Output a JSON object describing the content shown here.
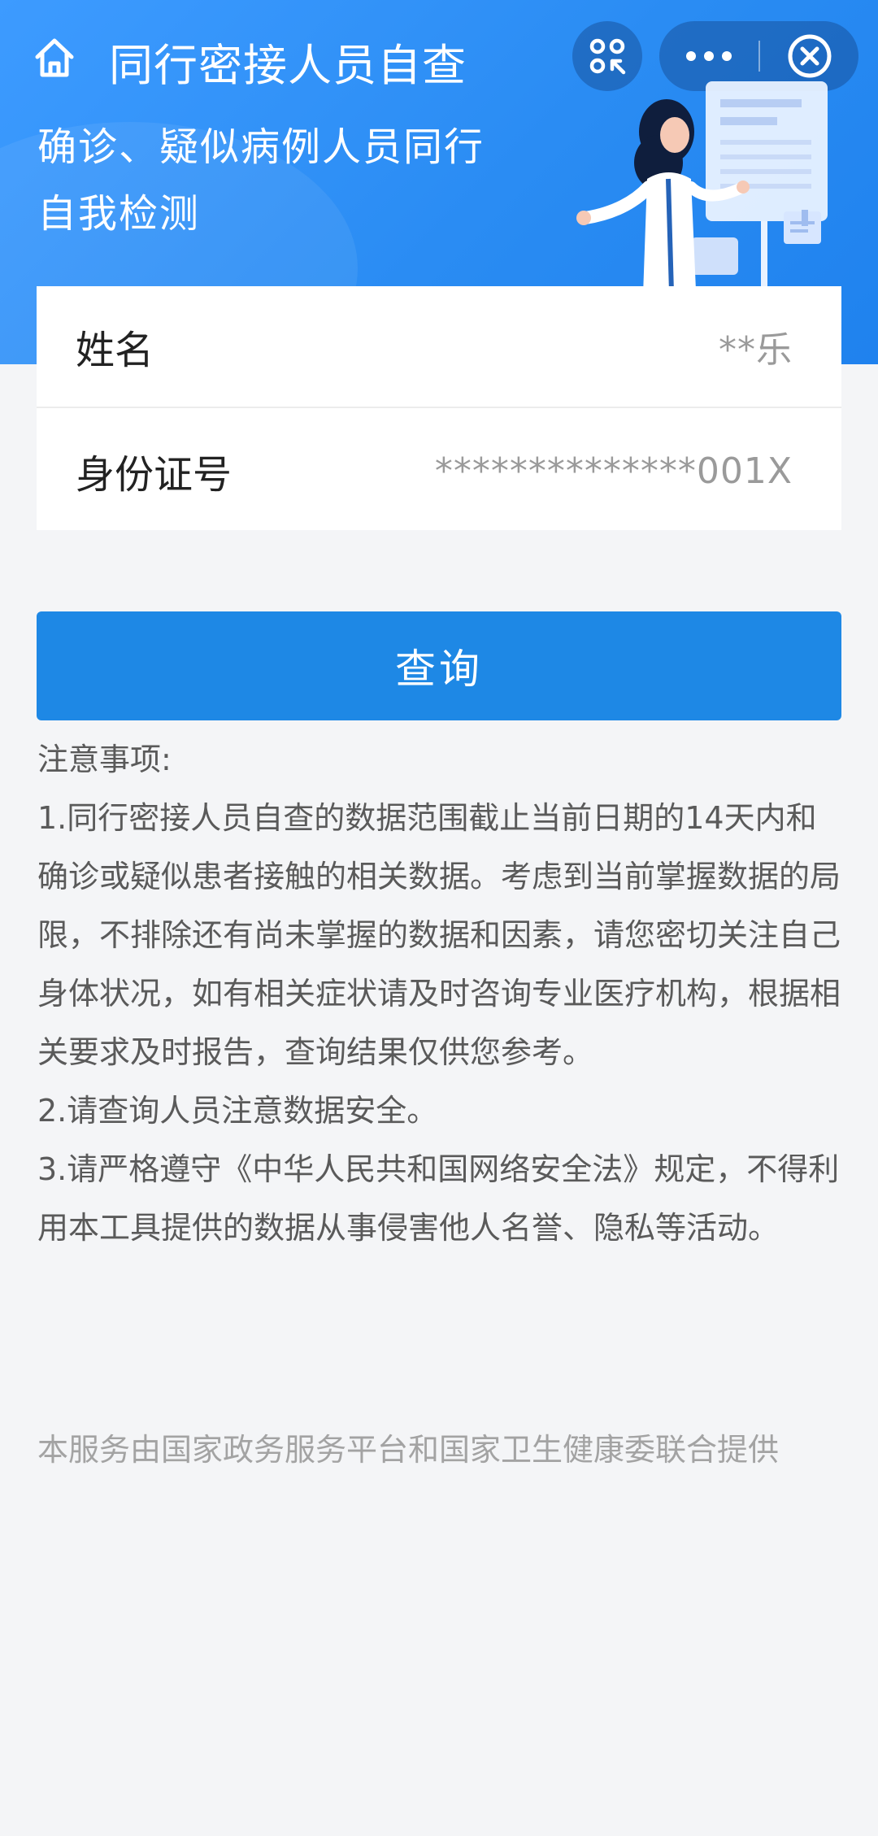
{
  "header": {
    "title": "同行密接人员自查",
    "subtitle_line1": "确诊、疑似病例人员同行",
    "subtitle_line2": "自我检测",
    "icons": {
      "home": "home-icon",
      "scan": "scan-icon",
      "more": "more-dots-icon",
      "close": "close-circle-icon"
    }
  },
  "form": {
    "name_label": "姓名",
    "name_value": "**乐",
    "id_label": "身份证号",
    "id_value": "**************001X"
  },
  "query_button_label": "查询",
  "notes": {
    "heading": "注意事项:",
    "item1": "1.同行密接人员自查的数据范围截止当前日期的14天内和确诊或疑似患者接触的相关数据。考虑到当前掌握数据的局限，不排除还有尚未掌握的数据和因素，请您密切关注自己身体状况，如有相关症状请及时咨询专业医疗机构，根据相关要求及时报告，查询结果仅供您参考。",
    "item2": "2.请查询人员注意数据安全。",
    "item3": "3.请严格遵守《中华人民共和国网络安全法》规定，不得利用本工具提供的数据从事侵害他人名誉、隐私等活动。"
  },
  "footer": "本服务由国家政务服务平台和国家卫生健康委联合提供",
  "colors": {
    "header_blue": "#2a8cf3",
    "button_blue": "#1e88e5",
    "background": "#f4f5f7"
  }
}
